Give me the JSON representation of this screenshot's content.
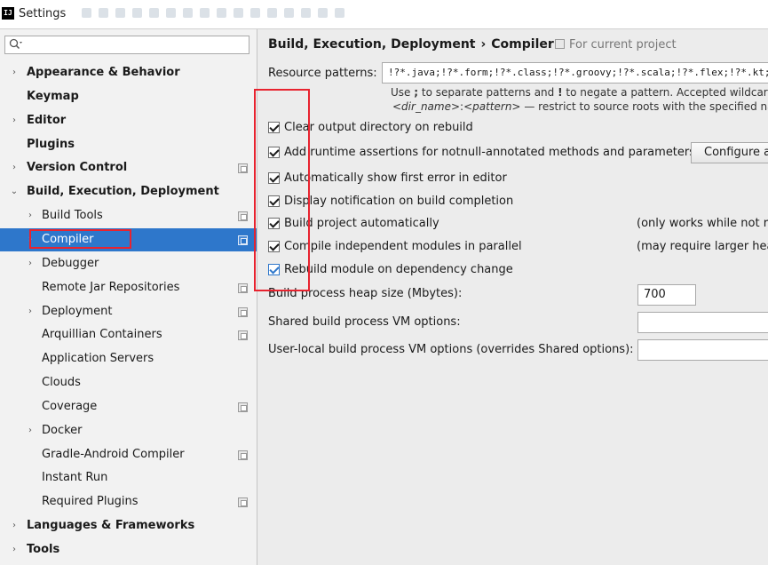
{
  "window": {
    "title": "Settings",
    "app_icon_text": "IJ"
  },
  "sidebar": {
    "search": {
      "value": "",
      "placeholder": ""
    },
    "items": [
      {
        "label": "Appearance & Behavior",
        "arrow": "›",
        "bold": true,
        "indent": 0
      },
      {
        "label": "Keymap",
        "arrow": "",
        "bold": true,
        "indent": 0
      },
      {
        "label": "Editor",
        "arrow": "›",
        "bold": true,
        "indent": 0
      },
      {
        "label": "Plugins",
        "arrow": "",
        "bold": true,
        "indent": 0
      },
      {
        "label": "Version Control",
        "arrow": "›",
        "bold": true,
        "indent": 0,
        "project": true
      },
      {
        "label": "Build, Execution, Deployment",
        "arrow": "⌄",
        "bold": true,
        "indent": 0
      },
      {
        "label": "Build Tools",
        "arrow": "›",
        "bold": false,
        "indent": 1,
        "project": true
      },
      {
        "label": "Compiler",
        "arrow": "›",
        "bold": false,
        "indent": 1,
        "project": true,
        "selected": true
      },
      {
        "label": "Debugger",
        "arrow": "›",
        "bold": false,
        "indent": 1
      },
      {
        "label": "Remote Jar Repositories",
        "arrow": "",
        "bold": false,
        "indent": 1,
        "project": true
      },
      {
        "label": "Deployment",
        "arrow": "›",
        "bold": false,
        "indent": 1,
        "project": true
      },
      {
        "label": "Arquillian Containers",
        "arrow": "",
        "bold": false,
        "indent": 1,
        "project": true
      },
      {
        "label": "Application Servers",
        "arrow": "",
        "bold": false,
        "indent": 1
      },
      {
        "label": "Clouds",
        "arrow": "",
        "bold": false,
        "indent": 1
      },
      {
        "label": "Coverage",
        "arrow": "",
        "bold": false,
        "indent": 1,
        "project": true
      },
      {
        "label": "Docker",
        "arrow": "›",
        "bold": false,
        "indent": 1
      },
      {
        "label": "Gradle-Android Compiler",
        "arrow": "",
        "bold": false,
        "indent": 1,
        "project": true
      },
      {
        "label": "Instant Run",
        "arrow": "",
        "bold": false,
        "indent": 1
      },
      {
        "label": "Required Plugins",
        "arrow": "",
        "bold": false,
        "indent": 1,
        "project": true
      },
      {
        "label": "Languages & Frameworks",
        "arrow": "›",
        "bold": true,
        "indent": 0
      },
      {
        "label": "Tools",
        "arrow": "›",
        "bold": true,
        "indent": 0
      }
    ]
  },
  "main": {
    "breadcrumb": {
      "parent": "Build, Execution, Deployment",
      "separator": "›",
      "current": "Compiler"
    },
    "scope_label": "For current project",
    "resource_patterns": {
      "label": "Resource patterns:",
      "value": "!?*.java;!?*.form;!?*.class;!?*.groovy;!?*.scala;!?*.flex;!?*.kt;!?*.clj;!?*.aj"
    },
    "hint_line1": {
      "use": "Use",
      "semicolon": ";",
      "middle": "to separate patterns and",
      "bang": "!",
      "end": "to negate a pattern. Accepted wildcards:",
      "question": "?",
      "dash": "—"
    },
    "hint_line2": {
      "dir_name": "<dir_name>",
      "colon": ":",
      "pattern": "<pattern>",
      "rest": "— restrict to source roots with the specified name"
    },
    "checkboxes": [
      {
        "label": "Clear output directory on rebuild",
        "checked": true
      },
      {
        "label": "Add runtime assertions for notnull-annotated methods and parameters",
        "checked": true
      },
      {
        "label": "Automatically show first error in editor",
        "checked": true
      },
      {
        "label": "Display notification on build completion",
        "checked": true
      },
      {
        "label": "Build project automatically",
        "checked": true,
        "note": "(only works while not running / debugging)"
      },
      {
        "label": "Compile independent modules in parallel",
        "checked": true,
        "note": "(may require larger heap size)"
      },
      {
        "label": "Rebuild module on dependency change",
        "checked": true,
        "focused": true
      }
    ],
    "configure_button": "Configure annotations...",
    "heap_size": {
      "label": "Build process heap size (Mbytes):",
      "value": "700"
    },
    "shared_vm": {
      "label": "Shared build process VM options:",
      "value": ""
    },
    "user_local_vm": {
      "label": "User-local build process VM options (overrides Shared options):",
      "value": ""
    }
  },
  "colors": {
    "selection": "#2e77cb",
    "annotation_red": "#e8232f",
    "sidebar_bg": "#f2f2f2",
    "content_bg": "#ececec"
  }
}
